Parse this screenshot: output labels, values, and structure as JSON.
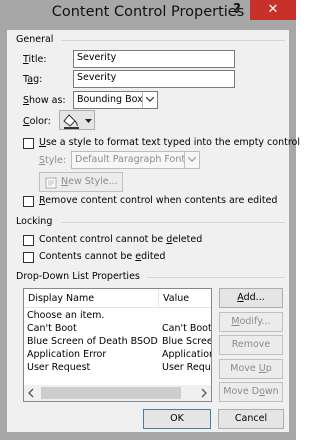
{
  "window": {
    "title": "Content Control Properties",
    "help": "?",
    "close": "✕"
  },
  "general": {
    "heading": "General",
    "title_label": "Title:",
    "title_value": "Severity",
    "tag_label": "Tag:",
    "tag_value": "Severity",
    "show_as_label": "Show as:",
    "show_as_value": "Bounding Box",
    "color_label": "Color:",
    "use_style_label": "Use a style to format text typed into the empty control",
    "style_label": "Style:",
    "style_value": "Default Paragraph Font",
    "new_style_label": "New Style...",
    "remove_label": "Remove content control when contents are edited"
  },
  "locking": {
    "heading": "Locking",
    "cannot_delete": "Content control cannot be deleted",
    "cannot_edit": "Contents cannot be edited"
  },
  "dropdown": {
    "heading": "Drop-Down List Properties",
    "columns": [
      "Display Name",
      "Value"
    ],
    "rows": [
      {
        "display": "Choose an item.",
        "value": ""
      },
      {
        "display": "Can't Boot",
        "value": "Can't Boot"
      },
      {
        "display": "Blue Screen of Death BSOD",
        "value": "Blue Screen"
      },
      {
        "display": "Application Error",
        "value": "Application"
      },
      {
        "display": "User Request",
        "value": "User Request"
      }
    ],
    "buttons": {
      "add": "Add...",
      "modify": "Modify...",
      "remove": "Remove",
      "move_up": "Move Up",
      "move_down": "Move Down"
    }
  },
  "footer": {
    "ok": "OK",
    "cancel": "Cancel"
  },
  "colors": {
    "close_red": "#c7312a",
    "titlebar": "#a7a7a7",
    "client": "#f0f0f0"
  }
}
